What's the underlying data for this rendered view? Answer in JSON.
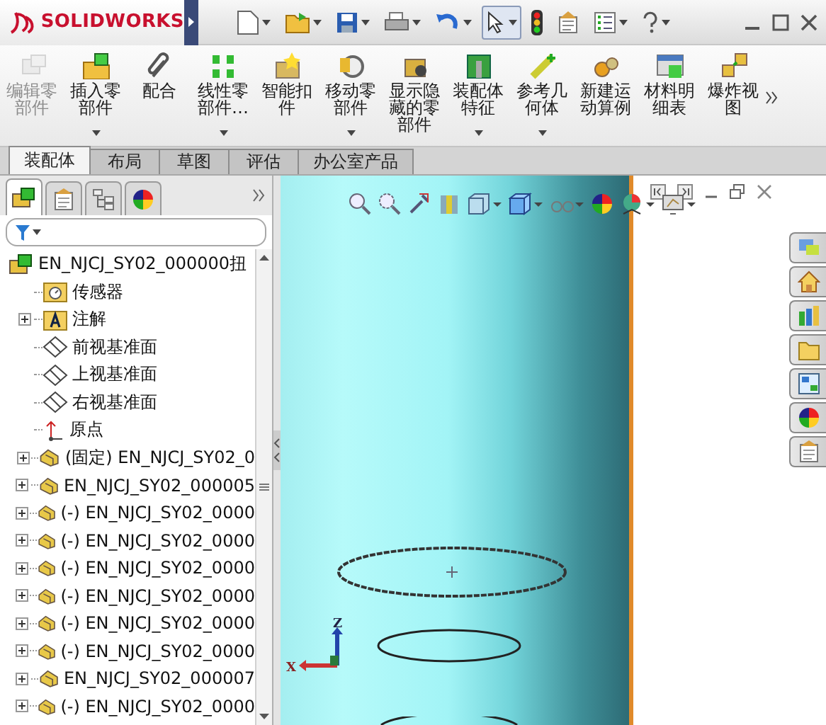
{
  "title_bar": {
    "logo": "SOLIDWORKS"
  },
  "quick_toolbar": [
    {
      "kind": "new",
      "dropdown": true,
      "selected": false
    },
    {
      "kind": "open",
      "dropdown": true,
      "selected": false
    },
    {
      "kind": "save",
      "dropdown": true,
      "selected": false
    },
    {
      "kind": "print",
      "dropdown": true,
      "selected": false
    },
    {
      "kind": "undo",
      "dropdown": true,
      "selected": false
    },
    {
      "kind": "select",
      "dropdown": true,
      "selected": true
    },
    {
      "kind": "rebuild",
      "dropdown": false,
      "selected": false
    },
    {
      "kind": "options",
      "dropdown": false,
      "selected": false
    },
    {
      "kind": "list",
      "dropdown": true,
      "selected": false
    },
    {
      "kind": "help",
      "dropdown": true,
      "selected": false
    }
  ],
  "ribbon": [
    {
      "label": "编辑零部件",
      "disabled": true,
      "dropdown": false
    },
    {
      "label": "插入零部件",
      "disabled": false,
      "dropdown": true
    },
    {
      "label": "配合",
      "disabled": false,
      "dropdown": false
    },
    {
      "label": "线性零部件…",
      "disabled": false,
      "dropdown": true
    },
    {
      "label": "智能扣件",
      "disabled": false,
      "dropdown": false
    },
    {
      "label": "移动零部件",
      "disabled": false,
      "dropdown": true
    },
    {
      "label": "显示隐藏的零部件",
      "disabled": false,
      "dropdown": false
    },
    {
      "label": "装配体特征",
      "disabled": false,
      "dropdown": true
    },
    {
      "label": "参考几何体",
      "disabled": false,
      "dropdown": true
    },
    {
      "label": "新建运动算例",
      "disabled": false,
      "dropdown": false
    },
    {
      "label": "材料明细表",
      "disabled": false,
      "dropdown": false
    },
    {
      "label": "爆炸视图",
      "disabled": false,
      "dropdown": false
    }
  ],
  "tabs": [
    {
      "label": "装配体",
      "selected": true
    },
    {
      "label": "布局",
      "selected": false
    },
    {
      "label": "草图",
      "selected": false
    },
    {
      "label": "评估",
      "selected": false
    },
    {
      "label": "办公室产品",
      "selected": false
    }
  ],
  "panel_tabs": [
    {
      "kind": "feature",
      "selected": true
    },
    {
      "kind": "property",
      "selected": false
    },
    {
      "kind": "config",
      "selected": false
    },
    {
      "kind": "display",
      "selected": false
    }
  ],
  "tree": {
    "label": "EN_NJCJ_SY02_000000扭",
    "kind": "assembly",
    "children": [
      {
        "label": "传感器",
        "kind": "sensor"
      },
      {
        "label": "注解",
        "kind": "annotation",
        "expanded": false
      },
      {
        "label": "前视基准面",
        "kind": "plane"
      },
      {
        "label": "上视基准面",
        "kind": "plane"
      },
      {
        "label": "右视基准面",
        "kind": "plane"
      },
      {
        "label": "原点",
        "kind": "origin"
      },
      {
        "label": "(固定) EN_NJCJ_SY02_0",
        "kind": "part",
        "expanded": false
      },
      {
        "label": "EN_NJCJ_SY02_000005",
        "kind": "part",
        "expanded": false
      },
      {
        "label": "(-) EN_NJCJ_SY02_0000",
        "kind": "part",
        "expanded": false
      },
      {
        "label": "(-) EN_NJCJ_SY02_0000",
        "kind": "part",
        "expanded": false
      },
      {
        "label": "(-) EN_NJCJ_SY02_0000",
        "kind": "part",
        "expanded": false
      },
      {
        "label": "(-) EN_NJCJ_SY02_0000",
        "kind": "part",
        "expanded": false
      },
      {
        "label": "(-) EN_NJCJ_SY02_0000",
        "kind": "part",
        "expanded": false
      },
      {
        "label": "(-) EN_NJCJ_SY02_0000",
        "kind": "part",
        "expanded": false
      },
      {
        "label": "EN_NJCJ_SY02_000007",
        "kind": "part",
        "expanded": false
      },
      {
        "label": "(-) EN_NJCJ_SY02_0000",
        "kind": "part",
        "expanded": false
      }
    ]
  },
  "triad": {
    "z": "Z",
    "x": "X"
  }
}
